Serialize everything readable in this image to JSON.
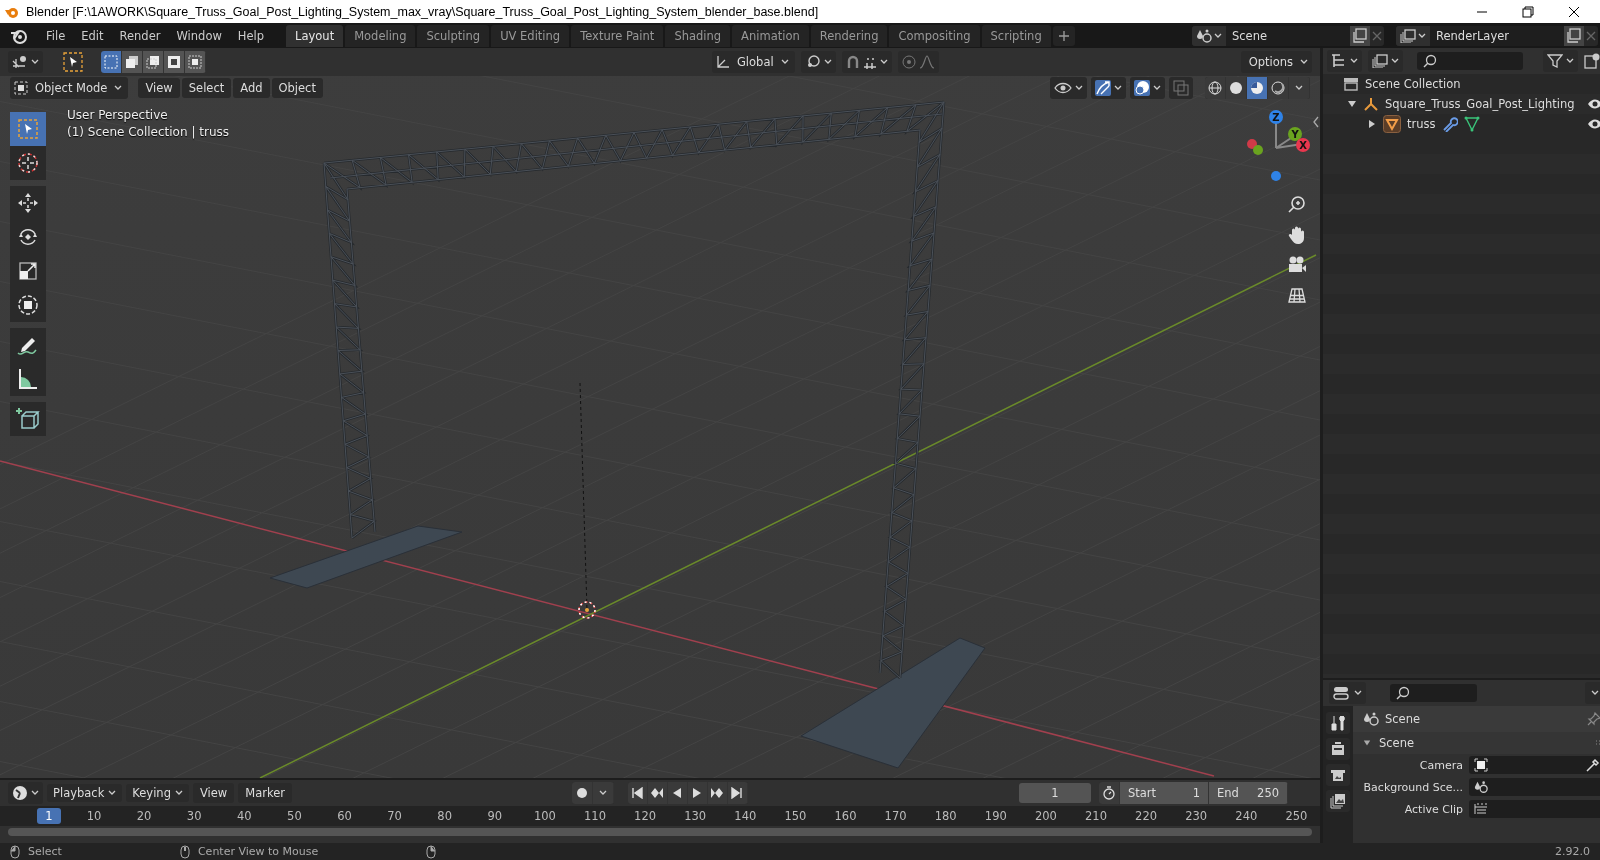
{
  "window": {
    "title": "Blender [F:\\1AWORK\\Square_Truss_Goal_Post_Lighting_System_max_vray\\Square_Truss_Goal_Post_Lighting_System_blender_base.blend]"
  },
  "menu": [
    "File",
    "Edit",
    "Render",
    "Window",
    "Help"
  ],
  "workspaces": [
    {
      "label": "Layout",
      "selected": true
    },
    {
      "label": "Modeling",
      "selected": false
    },
    {
      "label": "Sculpting",
      "selected": false
    },
    {
      "label": "UV Editing",
      "selected": false
    },
    {
      "label": "Texture Paint",
      "selected": false
    },
    {
      "label": "Shading",
      "selected": false
    },
    {
      "label": "Animation",
      "selected": false
    },
    {
      "label": "Rendering",
      "selected": false
    },
    {
      "label": "Compositing",
      "selected": false
    },
    {
      "label": "Scripting",
      "selected": false
    }
  ],
  "scene_field": "Scene",
  "view_layer_field": "RenderLayer",
  "tool_header": {
    "orientation": "Global",
    "options": "Options"
  },
  "viewport_header": {
    "mode": "Object Mode",
    "menus": [
      "View",
      "Select",
      "Add",
      "Object"
    ]
  },
  "shading": [
    {
      "kind": "wireframe",
      "selected": false
    },
    {
      "kind": "solid",
      "selected": false
    },
    {
      "kind": "material",
      "selected": true
    },
    {
      "kind": "rendered",
      "selected": false
    }
  ],
  "viewport": {
    "info": [
      "User Perspective",
      "(1) Scene Collection | truss"
    ],
    "gizmo": [
      {
        "label": "Z",
        "color": "#2f83e8"
      },
      {
        "label": "Y",
        "color": "#6aa31f"
      },
      {
        "label": "X",
        "color": "#e8374e"
      }
    ]
  },
  "toolbar": [
    {
      "kind": "select",
      "selected": true
    },
    {
      "kind": "cursor",
      "selected": false
    },
    {
      "kind": "move",
      "selected": false
    },
    {
      "kind": "rotate",
      "selected": false
    },
    {
      "kind": "scale",
      "selected": false
    },
    {
      "kind": "transform",
      "selected": false
    },
    {
      "kind": "annotate",
      "selected": false
    },
    {
      "kind": "measure",
      "selected": false
    },
    {
      "kind": "add_cube",
      "selected": false
    }
  ],
  "outliner": {
    "root": "Scene Collection",
    "children": [
      {
        "label": "Square_Truss_Goal_Post_Lighting",
        "expanded": true,
        "children": [
          {
            "label": "truss",
            "expanded": false
          }
        ]
      }
    ]
  },
  "properties": {
    "context": "Scene",
    "panel": {
      "title": "Scene",
      "expanded": true
    },
    "rows": [
      {
        "label": "Camera",
        "kind": "camera"
      },
      {
        "label": "Background Sce...",
        "kind": "scene"
      },
      {
        "label": "Active Clip",
        "kind": "clip"
      }
    ]
  },
  "timeline": {
    "menus": [
      "Playback",
      "Keying",
      "View",
      "Marker"
    ],
    "current_frame": "1",
    "start_label": "Start",
    "start": "1",
    "end_label": "End",
    "end": "250",
    "marker": "1",
    "ticks": [
      "10",
      "20",
      "30",
      "40",
      "50",
      "60",
      "70",
      "80",
      "90",
      "100",
      "110",
      "120",
      "130",
      "140",
      "150",
      "160",
      "170",
      "180",
      "190",
      "200",
      "210",
      "220",
      "230",
      "240",
      "250"
    ]
  },
  "status_bar": {
    "hints": [
      "Select",
      "Center View to Mouse"
    ],
    "version": "2.92.0"
  }
}
